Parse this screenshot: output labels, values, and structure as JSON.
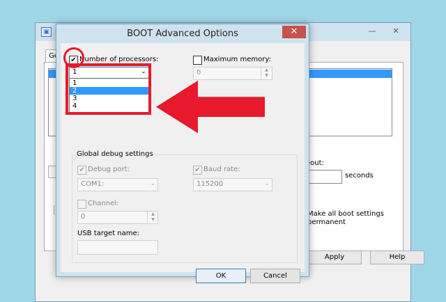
{
  "background_window": {
    "tab_label": "Ge",
    "timeout_label": "eout:",
    "seconds_label": "seconds",
    "make_permanent_label_line1": "Make all boot settings",
    "make_permanent_label_line2": "permanent",
    "apply_label": "Apply",
    "help_label": "Help",
    "minimize_glyph": "—",
    "close_glyph": "✕"
  },
  "dialog": {
    "title": "BOOT Advanced Options",
    "close_glyph": "✕",
    "number_of_processors": {
      "label": "Number of processors:",
      "checked": true,
      "check_glyph": "✔",
      "selected_value": "1",
      "options": [
        "1",
        "2",
        "3",
        "4"
      ],
      "highlighted_option": "2"
    },
    "maximum_memory": {
      "label": "Maximum memory:",
      "checked": false,
      "value": "0"
    },
    "debug": {
      "group_title": "Global debug settings",
      "debug_port_label": "Debug port:",
      "debug_port_checked": true,
      "debug_port_value": "COM1:",
      "baud_rate_label": "Baud rate:",
      "baud_rate_checked": true,
      "baud_rate_value": "115200",
      "channel_label": "Channel:",
      "channel_checked": false,
      "channel_value": "0",
      "usb_target_label": "USB target name:",
      "usb_target_value": ""
    },
    "ok_label": "OK",
    "cancel_label": "Cancel"
  },
  "icons": {
    "dropdown_arrow": "⌄",
    "spin_up": "▲",
    "spin_down": "▼"
  },
  "annotation_colors": {
    "highlight": "#e8192c"
  }
}
